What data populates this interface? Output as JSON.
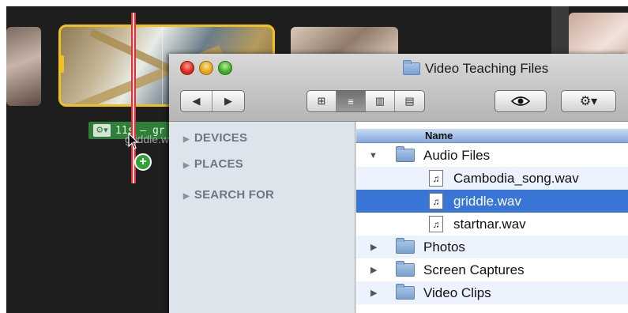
{
  "imovie": {
    "clip_label": "11s – gr",
    "drag_filename": "griddle.wav",
    "add_badge": "+"
  },
  "finder": {
    "title": "Video Teaching Files",
    "toolbar": {
      "back_icon": "◀",
      "forward_icon": "▶",
      "view_icons": [
        "⊞",
        "≡",
        "▥",
        "▤"
      ],
      "active_view_index": 1,
      "quick_look_icon": "eye-icon",
      "action_icon": "gear-icon"
    },
    "sidebar": {
      "sections": [
        "DEVICES",
        "PLACES",
        "SEARCH FOR"
      ]
    },
    "columns": {
      "name": "Name"
    },
    "items": [
      {
        "name": "Audio Files",
        "type": "folder",
        "expanded": true,
        "depth": 0
      },
      {
        "name": "Cambodia_song.wav",
        "type": "audio",
        "depth": 1
      },
      {
        "name": "griddle.wav",
        "type": "audio",
        "depth": 1,
        "selected": true
      },
      {
        "name": "startnar.wav",
        "type": "audio",
        "depth": 1
      },
      {
        "name": "Photos",
        "type": "folder",
        "expanded": false,
        "depth": 0
      },
      {
        "name": "Screen Captures",
        "type": "folder",
        "expanded": false,
        "depth": 0
      },
      {
        "name": "Video Clips",
        "type": "folder",
        "expanded": false,
        "depth": 0
      }
    ]
  },
  "colors": {
    "selection": "#3875d7",
    "clip_border": "#f2c21c",
    "audio_clip": "#2f7e3a",
    "playhead": "#e0303a"
  }
}
